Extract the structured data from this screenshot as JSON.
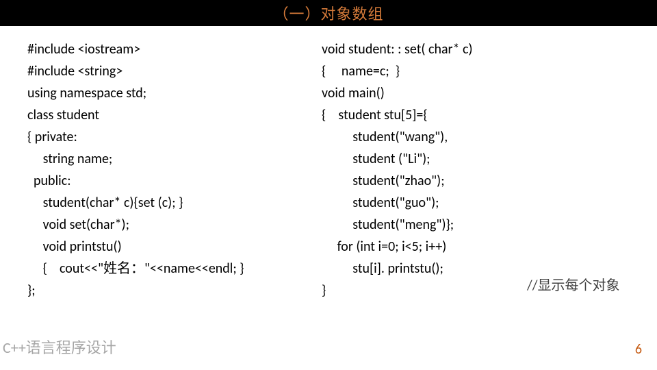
{
  "title": "（一）对象数组",
  "code": {
    "left": "#include <iostream>\n#include <string>\nusing namespace std;\nclass student\n{ private:\n     string name;\n  public:\n     student(char* c){set (c); }\n     void set(char*);\n     void printstu()\n     {    cout<<\"姓名：\"<<name<<endl; }\n};",
    "right": "void student: : set( char* c)\n{     name=c;  }\nvoid main()\n{    student stu[5]={\n          student(\"wang\"),\n          student (\"Li\");\n          student(\"zhao\");\n          student(\"guo\");\n          student(\"meng\")};\n     for (int i=0; i<5; i++)\n          stu[i]. printstu();\n}"
  },
  "comment": "//显示每个对象",
  "footer": {
    "left": "C++语言程序设计",
    "page": "6"
  }
}
